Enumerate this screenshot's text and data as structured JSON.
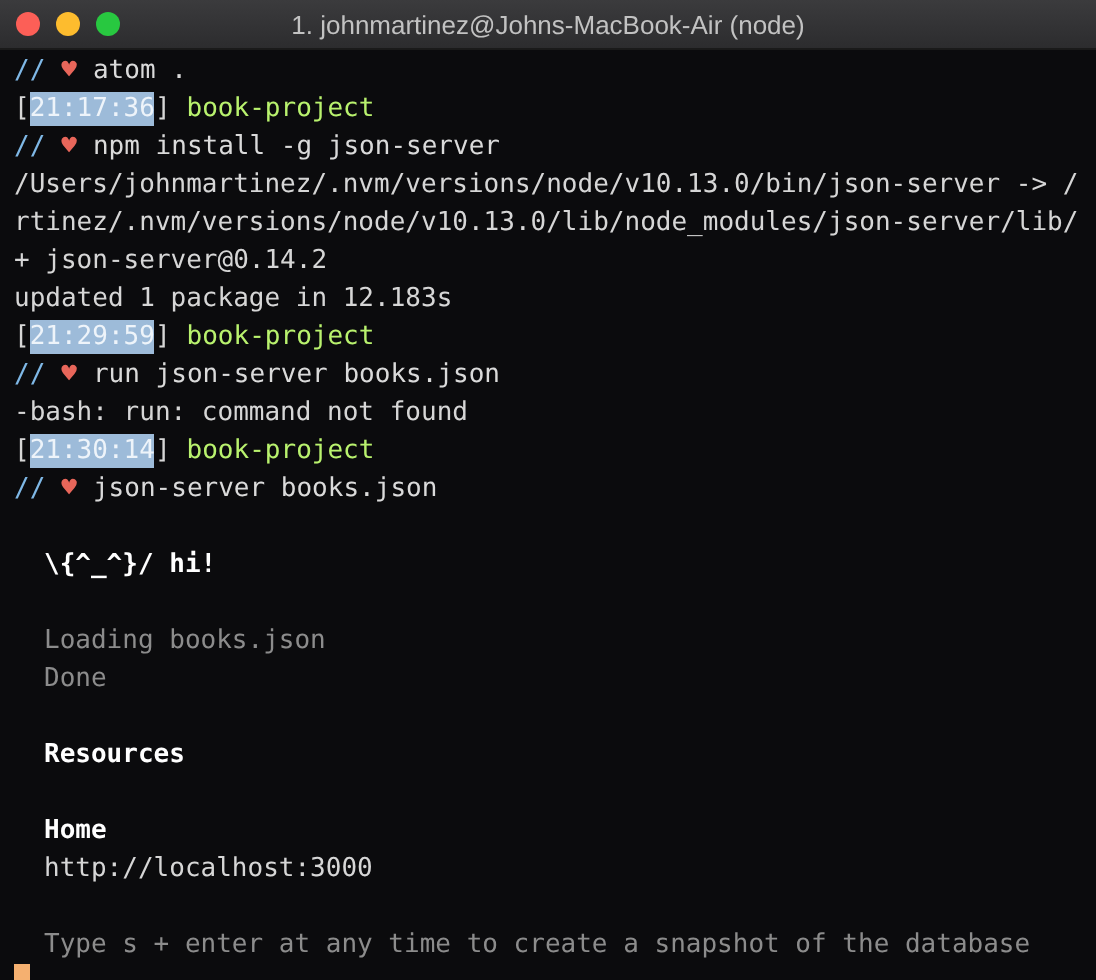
{
  "window": {
    "title": "1. johnmartinez@Johns-MacBook-Air (node)"
  },
  "lines": [
    {
      "kind": "command",
      "prompt": "//",
      "symbol": "♥",
      "text": "atom ."
    },
    {
      "kind": "stamp",
      "open": "[",
      "time": "21:17:36",
      "close": "]",
      "directory": "book-project",
      "selected": true
    },
    {
      "kind": "command",
      "prompt": "//",
      "symbol": "♥",
      "text": "npm install -g json-server"
    },
    {
      "kind": "output",
      "text": "/Users/johnmartinez/.nvm/versions/node/v10.13.0/bin/json-server -> /"
    },
    {
      "kind": "output",
      "text": "rtinez/.nvm/versions/node/v10.13.0/lib/node_modules/json-server/lib/"
    },
    {
      "kind": "output",
      "text": "+ json-server@0.14.2"
    },
    {
      "kind": "output",
      "text": "updated 1 package in 12.183s"
    },
    {
      "kind": "stamp",
      "open": "[",
      "time": "21:29:59",
      "close": "]",
      "directory": "book-project",
      "selected": true
    },
    {
      "kind": "command",
      "prompt": "//",
      "symbol": "♥",
      "text": "run json-server books.json"
    },
    {
      "kind": "output",
      "text": "-bash: run: command not found"
    },
    {
      "kind": "stamp",
      "open": "[",
      "time": "21:30:14",
      "close": "]",
      "directory": "book-project",
      "selected": true
    },
    {
      "kind": "command",
      "prompt": "//",
      "symbol": "♥",
      "text": "json-server books.json"
    },
    {
      "kind": "blank"
    },
    {
      "kind": "log_bold",
      "text": "\\{^_^}/ hi!"
    },
    {
      "kind": "blank"
    },
    {
      "kind": "log_dim",
      "text": "Loading books.json"
    },
    {
      "kind": "log_dim",
      "text": "Done"
    },
    {
      "kind": "blank"
    },
    {
      "kind": "log_bold",
      "text": "Resources"
    },
    {
      "kind": "blank"
    },
    {
      "kind": "log_bold",
      "text": "Home"
    },
    {
      "kind": "log",
      "text": "http://localhost:3000"
    },
    {
      "kind": "blank"
    },
    {
      "kind": "log_dim",
      "text": "Type s + enter at any time to create a snapshot of the database"
    }
  ]
}
